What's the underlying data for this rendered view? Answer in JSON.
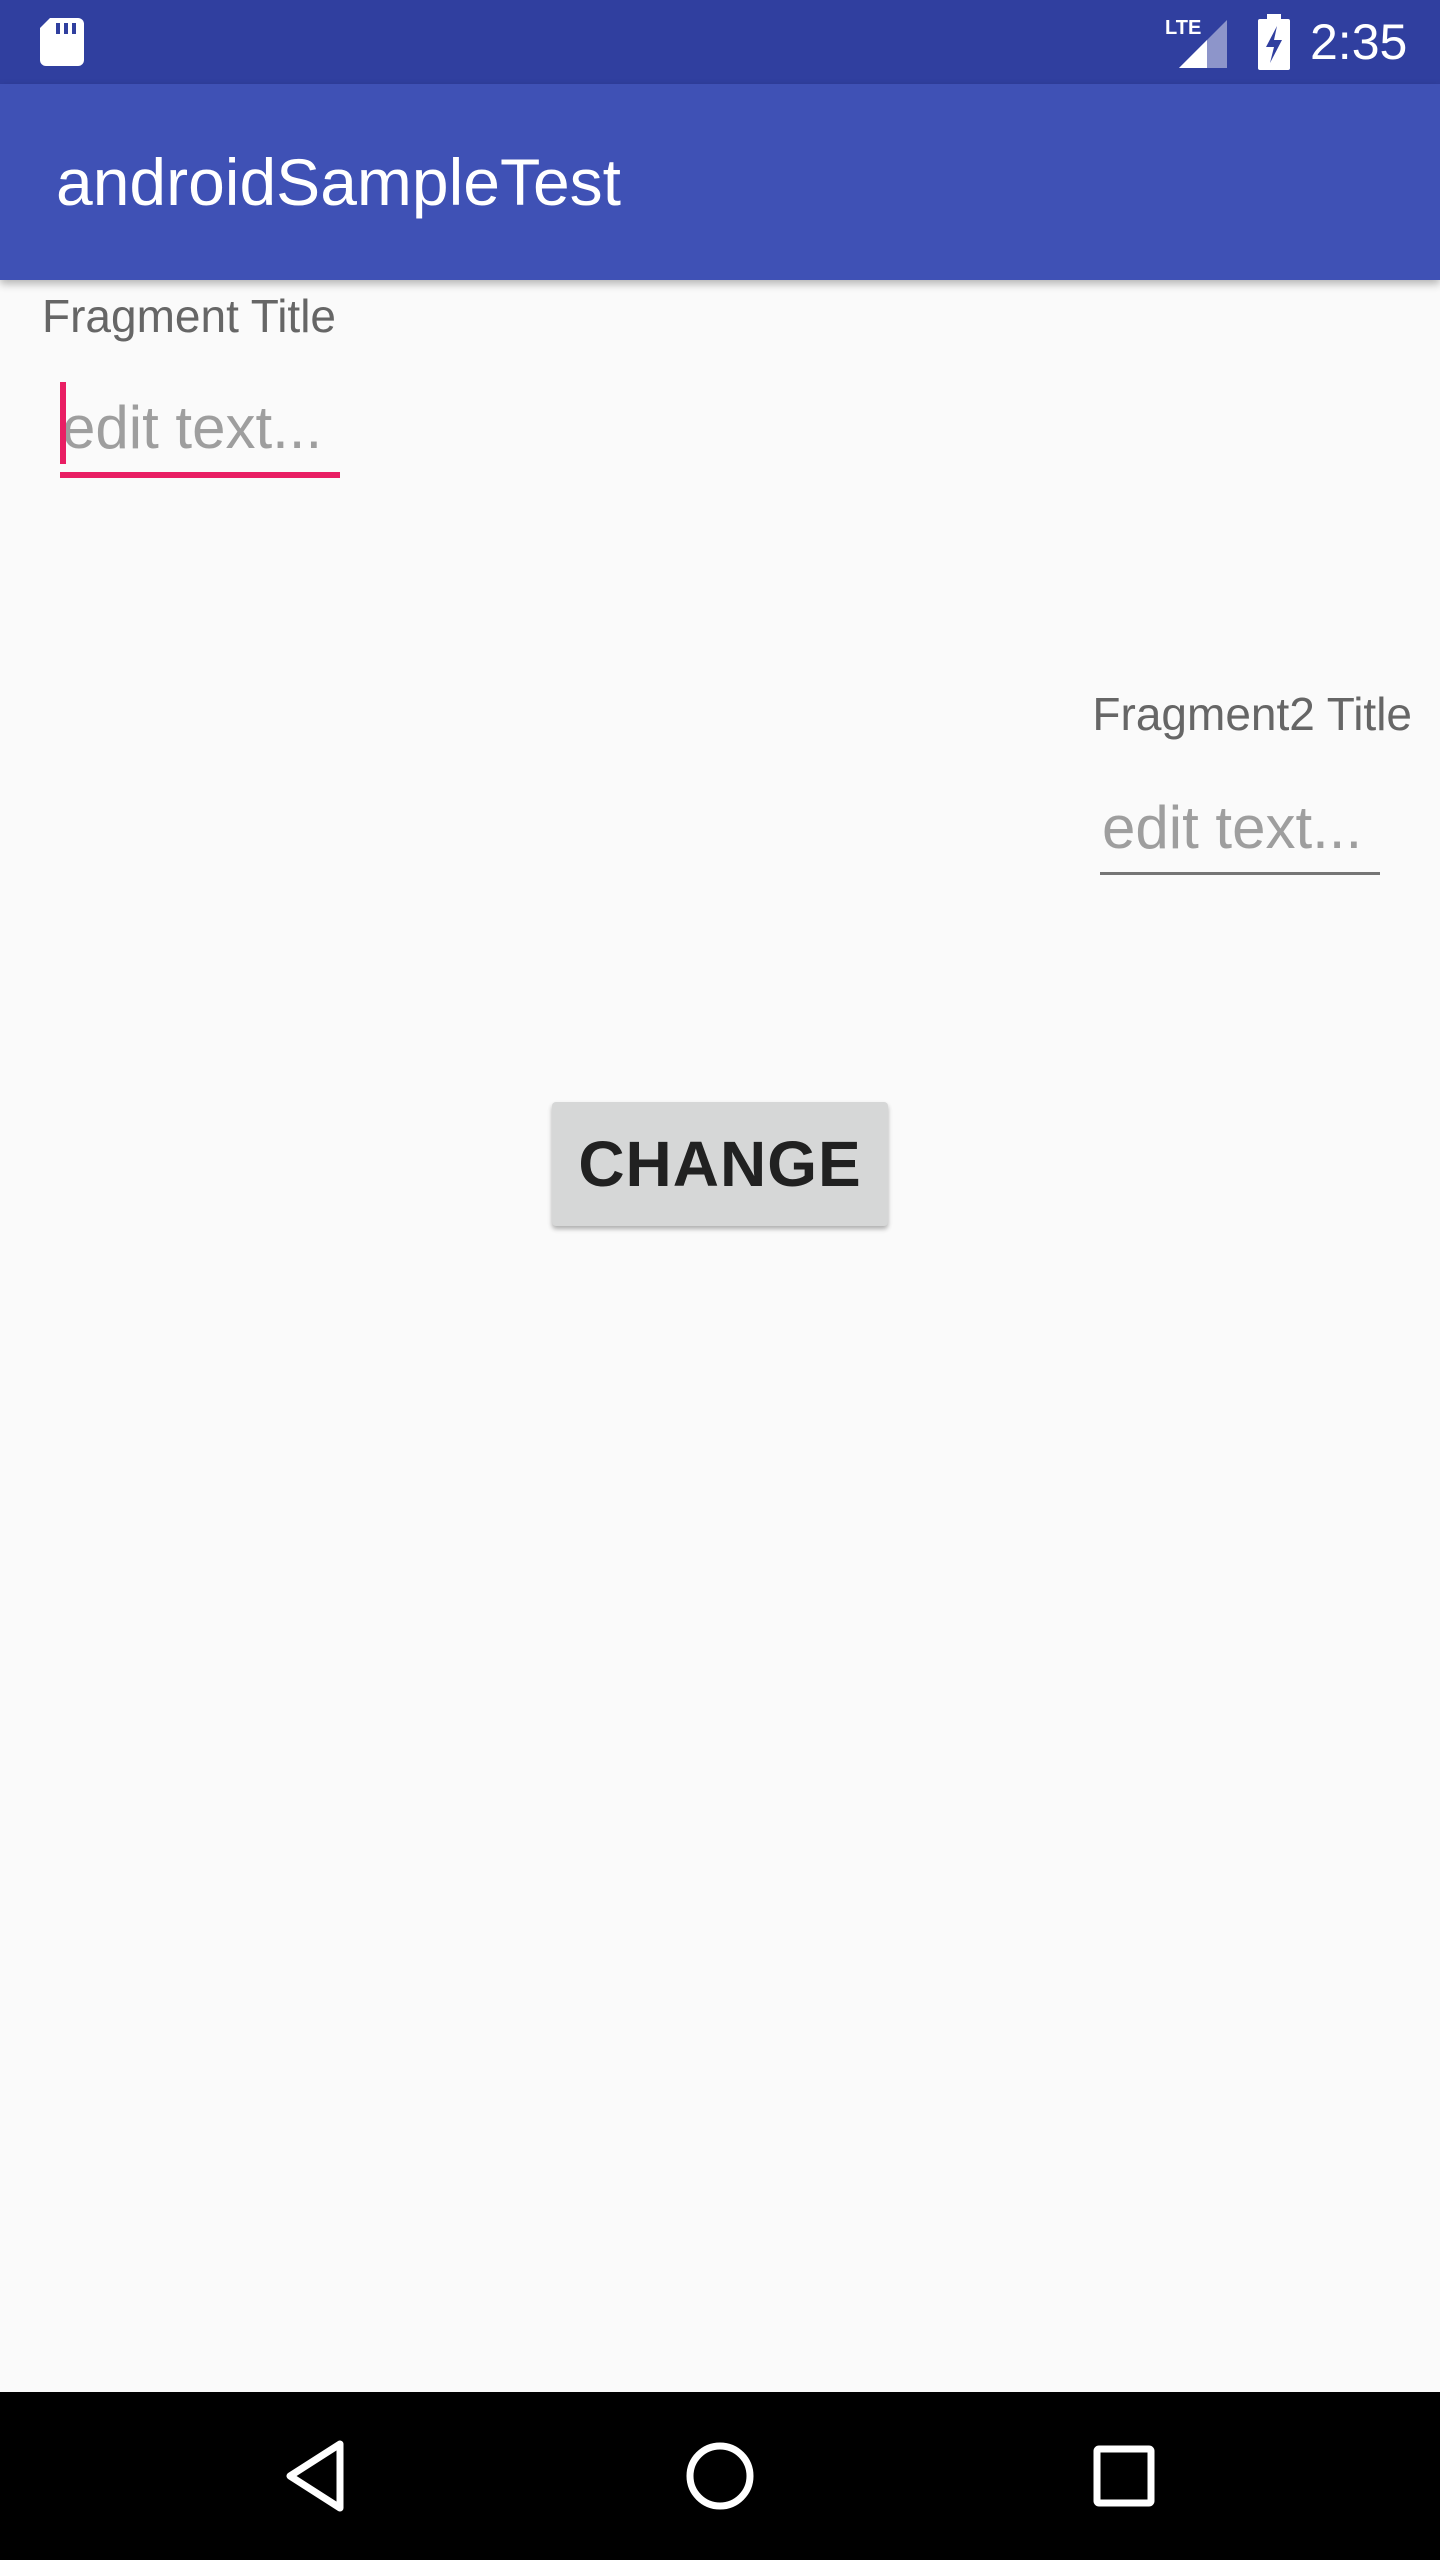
{
  "status_bar": {
    "time": "2:35",
    "icons": [
      "sd-card-icon",
      "lte-signal-icon",
      "battery-charging-icon"
    ],
    "color": "#303f9f"
  },
  "app_bar": {
    "title": "androidSampleTest",
    "color": "#3f51b5"
  },
  "fragment1": {
    "title": "Fragment Title",
    "edit_placeholder": "edit text...",
    "edit_value": "",
    "focused": true,
    "accent": "#e91e63"
  },
  "fragment2": {
    "title": "Fragment2 Title",
    "edit_placeholder": "edit text...",
    "edit_value": ""
  },
  "change_button": {
    "label": "CHANGE"
  },
  "nav_bar": {
    "buttons": [
      "back-icon",
      "home-icon",
      "recents-icon"
    ]
  }
}
